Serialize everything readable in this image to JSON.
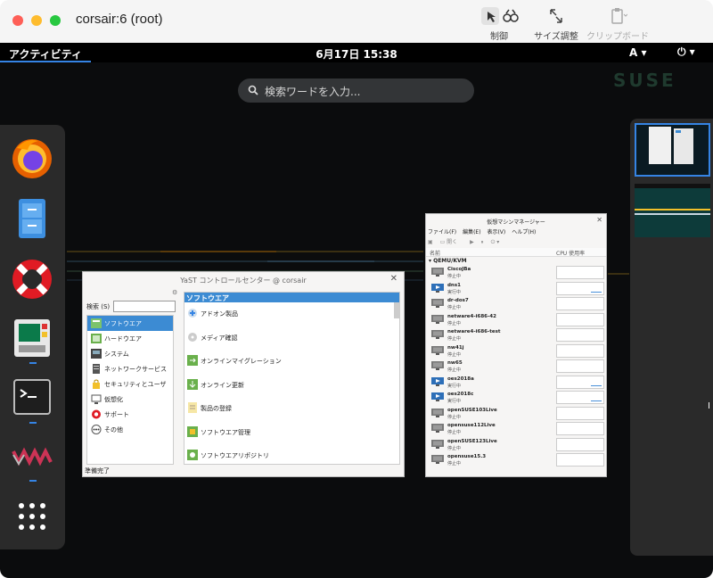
{
  "window": {
    "title": "corsair:6 (root)",
    "toolbar": {
      "control_label": "制御",
      "resize_label": "サイズ調整",
      "clipboard_label": "クリップボード"
    }
  },
  "topbar": {
    "activities": "アクティビティ",
    "clock": "6月17日  15:38",
    "keyboard": "A ▾",
    "power": "⏻ ▾"
  },
  "brand": {
    "logo": "SUSE"
  },
  "search": {
    "placeholder": "検索ワードを入力..."
  },
  "dash": {
    "apps": [
      {
        "name": "Firefox",
        "icon": "firefox-icon"
      },
      {
        "name": "Files",
        "icon": "file-cabinet-icon"
      },
      {
        "name": "Help",
        "icon": "lifebuoy-icon"
      },
      {
        "name": "YaST",
        "icon": "yast-icon"
      },
      {
        "name": "Terminal",
        "icon": "terminal-icon"
      },
      {
        "name": "Virtual Machine Manager",
        "icon": "vmm-icon"
      },
      {
        "name": "Show Applications",
        "icon": "app-grid-icon"
      }
    ]
  },
  "yast": {
    "title": "YaST コントロールセンター @ corsair",
    "search_label": "検索 (S)",
    "categories": [
      {
        "label": "ソフトウエア",
        "icon": "software-icon"
      },
      {
        "label": "ハードウエア",
        "icon": "hardware-icon"
      },
      {
        "label": "システム",
        "icon": "system-icon"
      },
      {
        "label": "ネットワークサービス",
        "icon": "network-icon"
      },
      {
        "label": "セキュリティとユーザ",
        "icon": "lock-icon"
      },
      {
        "label": "仮想化",
        "icon": "virtualization-icon"
      },
      {
        "label": "サポート",
        "icon": "support-icon"
      },
      {
        "label": "その他",
        "icon": "more-icon"
      }
    ],
    "selected_category": "ソフトウエア",
    "section_header": "ソフトウエア",
    "items": [
      {
        "label": "アドオン製品",
        "icon": "addon-icon"
      },
      {
        "label": "メディア確認",
        "icon": "media-check-icon"
      },
      {
        "label": "オンラインマイグレーション",
        "icon": "migration-icon"
      },
      {
        "label": "オンライン更新",
        "icon": "online-update-icon"
      },
      {
        "label": "製品の登録",
        "icon": "registration-icon"
      },
      {
        "label": "ソフトウエア管理",
        "icon": "software-management-icon"
      },
      {
        "label": "ソフトウエアリポジトリ",
        "icon": "repository-icon"
      }
    ],
    "status": "準備完了"
  },
  "vmm": {
    "title": "仮想マシンマネージャー",
    "menu": [
      "ファイル(F)",
      "編集(E)",
      "表示(V)",
      "ヘルプ(H)"
    ],
    "toolbar_open": "開く",
    "columns": {
      "name": "名前",
      "cpu": "CPU 使用率"
    },
    "group": "QEMU/KVM",
    "vms": [
      {
        "name": "CiscoJBa",
        "state": "停止中"
      },
      {
        "name": "dns1",
        "state": "実行中"
      },
      {
        "name": "dr-dos7",
        "state": "停止中"
      },
      {
        "name": "netware4-i686-42",
        "state": "停止中"
      },
      {
        "name": "netware4-i686-test",
        "state": "停止中"
      },
      {
        "name": "nw41j",
        "state": "停止中"
      },
      {
        "name": "nw65",
        "state": "停止中"
      },
      {
        "name": "oes2018a",
        "state": "実行中"
      },
      {
        "name": "oes2018c",
        "state": "実行中"
      },
      {
        "name": "openSUSE103Live",
        "state": "停止中"
      },
      {
        "name": "opensuse112Live",
        "state": "停止中"
      },
      {
        "name": "openSUSE123Live",
        "state": "停止中"
      },
      {
        "name": "opensuse15.3",
        "state": "停止中"
      }
    ]
  },
  "colors": {
    "accent": "#3584e4",
    "yast_selection": "#3c8bd3",
    "panel": "#2a2a2a"
  }
}
